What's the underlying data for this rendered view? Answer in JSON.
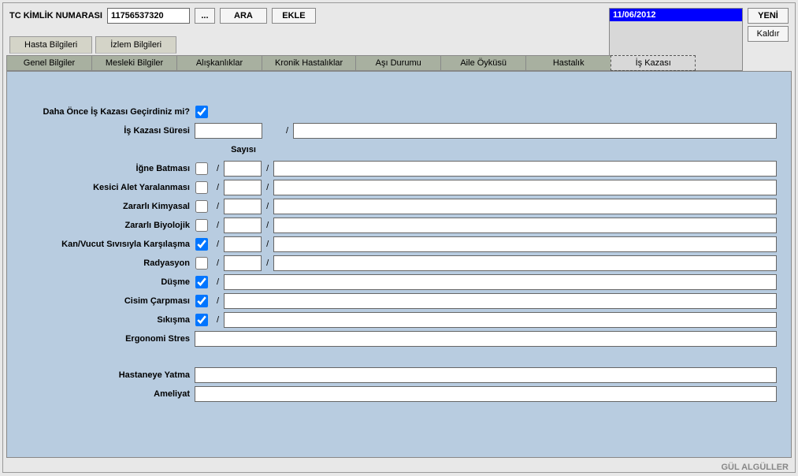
{
  "top": {
    "tc_label": "TC KİMLİK NUMARASI",
    "tc_value": "11756537320",
    "browse_label": "...",
    "ara_label": "ARA",
    "ekle_label": "EKLE"
  },
  "right_panel": {
    "date": "11/06/2012",
    "yeni_label": "YENİ",
    "kaldir_label": "Kaldır"
  },
  "main_tabs": {
    "hasta": "Hasta Bilgileri",
    "izlem": "İzlem Bilgileri"
  },
  "sub_tabs": [
    "Genel Bilgiler",
    "Mesleki Bilgiler",
    "Alışkanlıklar",
    "Kronik Hastalıklar",
    "Aşı Durumu",
    "Aile Öyküsü",
    "Hastalık",
    "İş Kazası"
  ],
  "form": {
    "prev_accident_label": "Daha Önce İş Kazası Geçirdiniz mi?",
    "prev_accident_checked": true,
    "duration_label": "İş Kazası Süresi",
    "count_header": "Sayısı",
    "rows": {
      "igne": {
        "label": "İğne Batması",
        "checked": false
      },
      "kesici": {
        "label": "Kesici Alet Yaralanması",
        "checked": false
      },
      "kimyasal": {
        "label": "Zararlı Kimyasal",
        "checked": false
      },
      "biyolojik": {
        "label": "Zararlı Biyolojik",
        "checked": false
      },
      "kan": {
        "label": "Kan/Vucut Sıvısıyla Karşılaşma",
        "checked": true
      },
      "radyasyon": {
        "label": "Radyasyon",
        "checked": false
      },
      "dusme": {
        "label": "Düşme",
        "checked": true
      },
      "cisim": {
        "label": "Cisim Çarpması",
        "checked": true
      },
      "sikisma": {
        "label": "Sıkışma",
        "checked": true
      }
    },
    "ergonomi_label": "Ergonomi Stres",
    "hastane_label": "Hastaneye Yatma",
    "ameliyat_label": "Ameliyat"
  },
  "status_bar": "GÜL ALGÜLLER"
}
